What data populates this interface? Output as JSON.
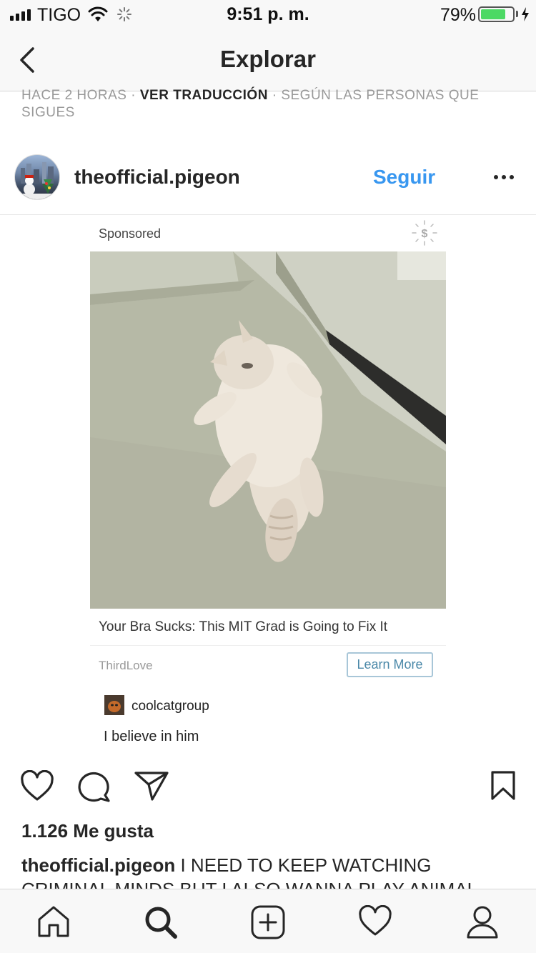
{
  "status_bar": {
    "carrier": "TIGO",
    "time": "9:51 p. m.",
    "battery": "79%",
    "battery_level": 0.79
  },
  "nav": {
    "title": "Explorar",
    "back_icon": "chevron-left-icon"
  },
  "post_meta": {
    "time_ago": "HACE 2 HORAS",
    "separator": "·",
    "translate": "VER TRADUCCIÓN",
    "reason": "SEGÚN LAS PERSONAS QUE SIGUES"
  },
  "post": {
    "username": "theofficial.pigeon",
    "follow_label": "Seguir",
    "more_icon": "more-horizontal-icon",
    "likes": "1.126 Me gusta",
    "caption_user": "theofficial.pigeon",
    "caption_text": "I NEED TO KEEP WATCHING CRIMINAL MINDS BUT I ALSO WANNA PLAY ANIMAL"
  },
  "embedded_ad": {
    "sponsored": "Sponsored",
    "headline": "Your Bra Sucks: This MIT Grad is Going to Fix It",
    "advertiser": "ThirdLove",
    "cta": "Learn More",
    "comment_user": "coolcatgroup",
    "comment_text": "I believe in him"
  },
  "actions": [
    "heart-icon",
    "comment-icon",
    "share-icon",
    "bookmark-icon"
  ],
  "tabbar": [
    "home-icon",
    "search-icon",
    "add-post-icon",
    "activity-heart-icon",
    "profile-icon"
  ],
  "colors": {
    "link_blue": "#3897f0",
    "battery_green": "#4cd964",
    "text": "#262626",
    "muted": "#999999"
  }
}
